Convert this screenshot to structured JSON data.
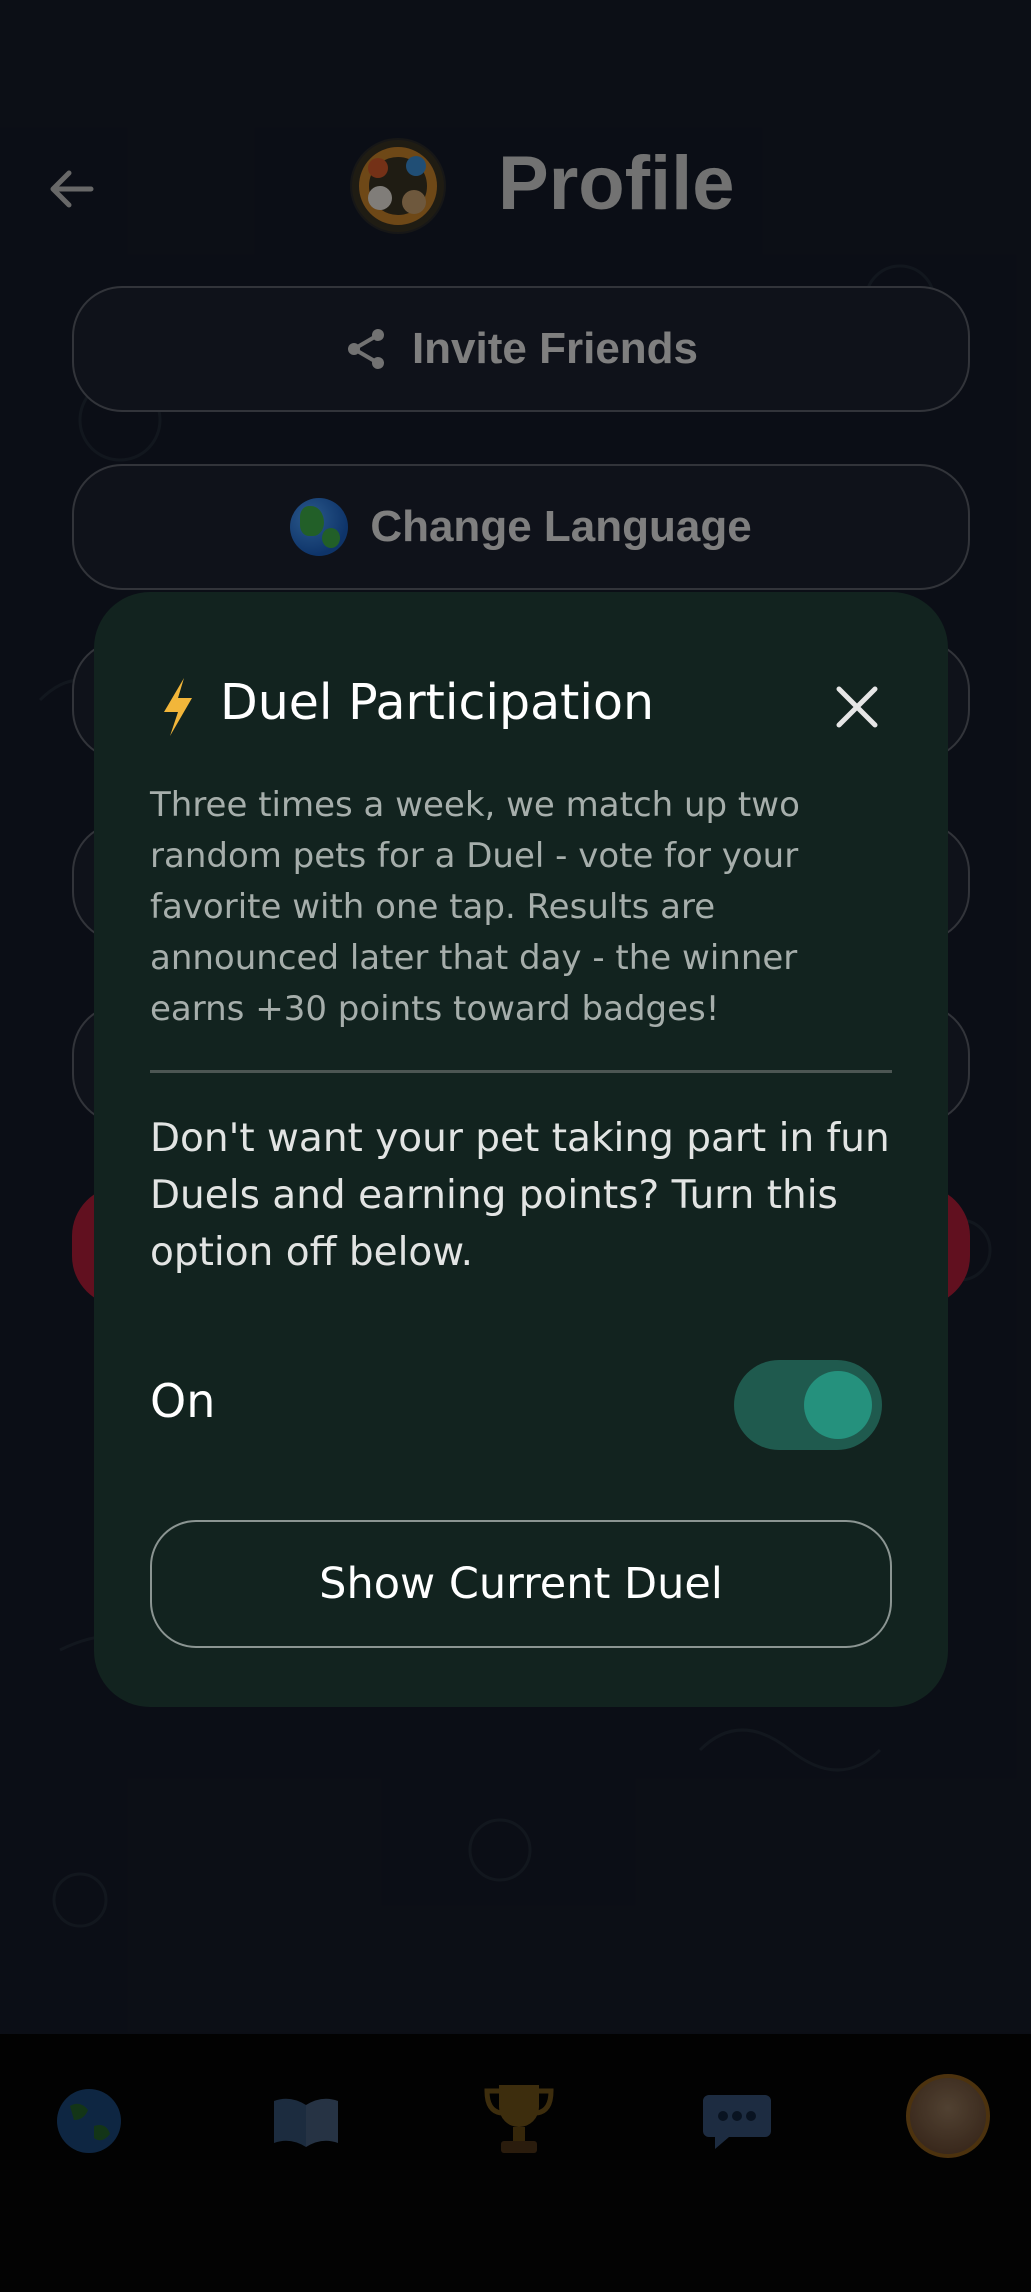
{
  "header": {
    "title": "Profile"
  },
  "profile_actions": {
    "invite_label": "Invite Friends",
    "language_label": "Change Language"
  },
  "modal": {
    "title": "Duel Participation",
    "description": "Three times a week, we match up two random pets for a Duel - vote for your favorite with one tap. Results are announced later that day - the winner earns +30 points toward badges!",
    "note": "Don't want your pet taking part in fun Duels and earning points? Turn this option off below.",
    "toggle_label": "On",
    "toggle_state": "on",
    "button_label": "Show Current Duel"
  },
  "colors": {
    "modal_bg": "#12231f",
    "toggle_track": "#1f5a4e",
    "toggle_knob": "#25917d",
    "danger": "#b11e3a",
    "avatar_ring": "#d18a28"
  },
  "bottom_nav": {
    "items": [
      "globe-icon",
      "book-icon",
      "trophy-icon",
      "chat-bubble-icon",
      "avatar"
    ]
  }
}
